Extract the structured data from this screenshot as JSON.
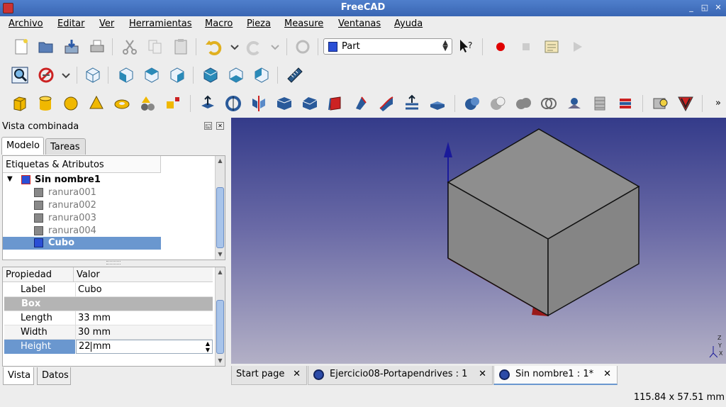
{
  "window": {
    "title": "FreeCAD",
    "minimize": "_",
    "restore": "◱",
    "close": "✕"
  },
  "menu": [
    "Archivo",
    "Editar",
    "Ver",
    "Herramientas",
    "Macro",
    "Pieza",
    "Measure",
    "Ventanas",
    "Ayuda"
  ],
  "workbench": {
    "selected": "Part"
  },
  "toolbar_more": "»",
  "combo": {
    "title": "Vista combinada",
    "tabs": [
      "Modelo",
      "Tareas"
    ],
    "tree_header": "Etiquetas & Atributos",
    "root": "Sin nombre1",
    "items": [
      "ranura001",
      "ranura002",
      "ranura003",
      "ranura004",
      "Cubo"
    ],
    "selected_item": "Cubo"
  },
  "properties": {
    "col_property": "Propiedad",
    "col_value": "Valor",
    "label_key": "Label",
    "label_value": "Cubo",
    "group": "Box",
    "length_key": "Length",
    "length_value": "33 mm",
    "width_key": "Width",
    "width_value": "30 mm",
    "height_key": "Height",
    "height_value": "22",
    "height_unit": "mm"
  },
  "bottom_tabs": [
    "Vista",
    "Datos"
  ],
  "doc_tabs": [
    "Start page",
    "Ejercicio08-Portapendrives : 1",
    "Sin nombre1 : 1*"
  ],
  "active_doc_tab": "Sin nombre1 : 1*",
  "axis_labels": [
    "Z",
    "Y",
    "X"
  ],
  "status": {
    "coordinates": "115.84 x 57.51 mm"
  },
  "colors": {
    "titlebar": "#3a66b3",
    "selection": "#6a97cf",
    "accent_record": "#e00000",
    "cube_face": "#858585"
  }
}
